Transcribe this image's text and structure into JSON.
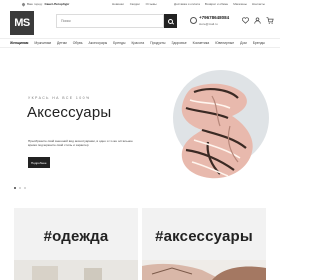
{
  "topbar": {
    "city_prefix": "Ваш город:",
    "city": "Санкт-Петербург",
    "links": [
      "Новинки",
      "Скидки",
      "Отзывы"
    ],
    "links2": [
      "Доставка и оплата",
      "Возврат и обмен",
      "Магазины",
      "Контакты"
    ]
  },
  "header": {
    "logo": "MS",
    "search_placeholder": "Поиск",
    "phone": "+79678648084",
    "email": "store@mail.ru"
  },
  "nav": [
    "Женщинам",
    "Мужчинам",
    "Детям",
    "Обувь",
    "Аксессуары",
    "Бренды",
    "Красота",
    "Продукты",
    "Здоровье",
    "Косметика",
    "Ювелирные",
    "Дом",
    "Бренды"
  ],
  "hero": {
    "subtitle": "УКРАСЬ НА ВСЕ 100%",
    "title": "Аксессуары",
    "description": "Преобразите свой внешний вид аксессуарами, в одно и то же остальное время подчеркните свой стиль и характер",
    "button": "Подробнее"
  },
  "slider": {
    "count": 3,
    "active": 0
  },
  "tiles": [
    {
      "title": "#одежда"
    },
    {
      "title": "#аксессуары"
    }
  ],
  "colors": {
    "dark": "#222222",
    "circle": "#dfe3e6",
    "tile": "#f2f2f2",
    "accent_scarf": "#e8b9ad"
  }
}
